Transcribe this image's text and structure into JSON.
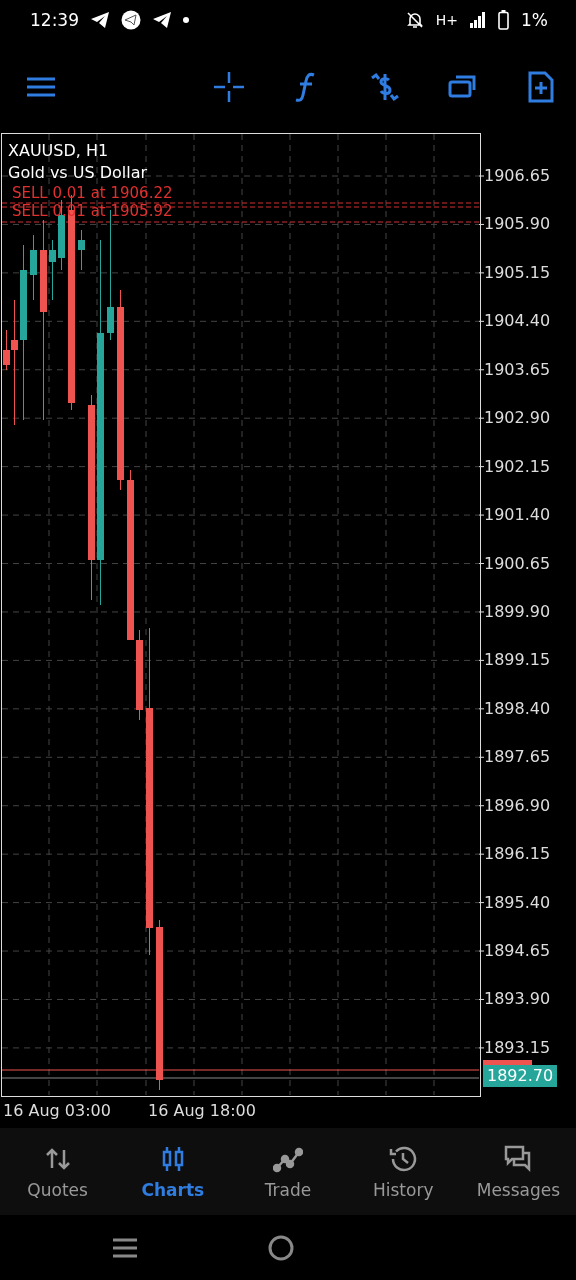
{
  "status_bar": {
    "time": "12:39",
    "network": "H+",
    "battery": "1%"
  },
  "chart": {
    "symbol": "XAUUSD, H1",
    "description": "Gold vs US Dollar",
    "orders": [
      {
        "label": "SELL 0.01 at 1906.22"
      },
      {
        "label": "SELL 0.01 at 1905.92"
      }
    ],
    "price_axis": [
      "1906.65",
      "1905.90",
      "1905.15",
      "1904.40",
      "1903.65",
      "1902.90",
      "1902.15",
      "1901.40",
      "1900.65",
      "1899.90",
      "1899.15",
      "1898.40",
      "1897.65",
      "1896.90",
      "1896.15",
      "1895.40",
      "1894.65",
      "1893.90",
      "1893.15"
    ],
    "current_price": "1892.70",
    "time_axis": [
      "16 Aug 03:00",
      "16 Aug 18:00"
    ]
  },
  "bottom_nav": [
    {
      "label": "Quotes",
      "kind": "quotes",
      "selected": false
    },
    {
      "label": "Charts",
      "kind": "charts",
      "selected": true
    },
    {
      "label": "Trade",
      "kind": "trade",
      "selected": false
    },
    {
      "label": "History",
      "kind": "history",
      "selected": false
    },
    {
      "label": "Messages",
      "kind": "messages",
      "selected": false
    }
  ]
}
